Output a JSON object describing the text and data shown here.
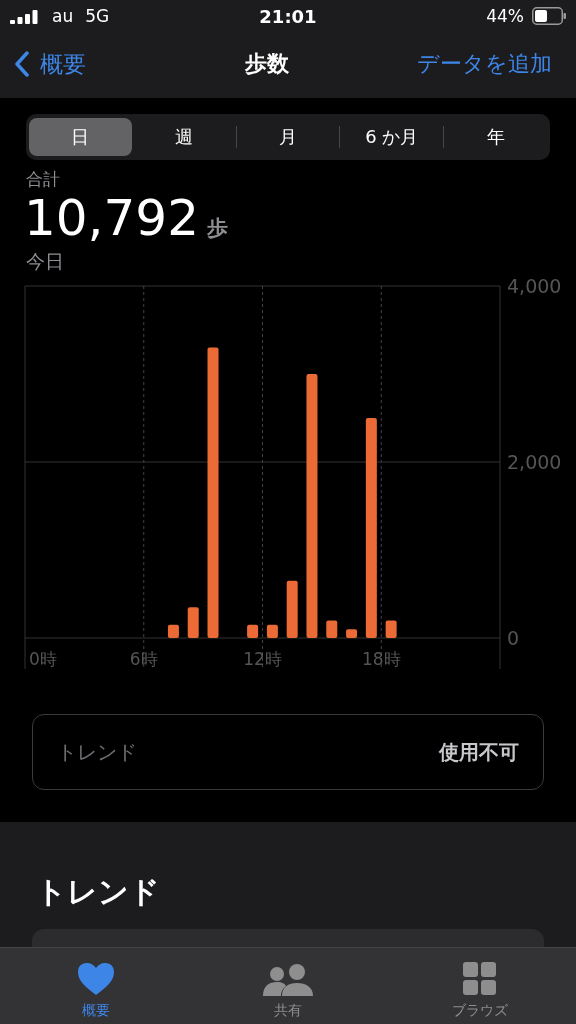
{
  "status_bar": {
    "carrier": "au",
    "network": "5G",
    "time": "21:01",
    "battery": "44%"
  },
  "nav": {
    "back": "概要",
    "title": "歩数",
    "action": "データを追加"
  },
  "segments": [
    {
      "label": "日",
      "selected": true
    },
    {
      "label": "週",
      "selected": false
    },
    {
      "label": "月",
      "selected": false
    },
    {
      "label": "6 か月",
      "selected": false
    },
    {
      "label": "年",
      "selected": false
    }
  ],
  "summary": {
    "label": "合計",
    "value": "10,792",
    "unit": "歩",
    "period": "今日"
  },
  "chart": {
    "chart_data": {
      "type": "bar",
      "grid": true,
      "ref_lines": [
        {
          "axis": "y",
          "value": 2000
        }
      ],
      "x": [
        7.5,
        8.5,
        9.5,
        11.5,
        12.5,
        13.5,
        14.5,
        15.5,
        16.5,
        17.5,
        18.5
      ],
      "xlim": [
        0,
        24
      ],
      "series": [
        {
          "color": "#ec6a35",
          "values": [
            150,
            350,
            3300,
            150,
            150,
            650,
            3000,
            200,
            100,
            2500,
            200
          ]
        }
      ],
      "ylim": [
        0,
        4000
      ],
      "yticks": [
        {
          "value": 0,
          "label": "0"
        },
        {
          "value": 2000,
          "label": "2,000"
        },
        {
          "value": 4000,
          "label": "4,000"
        }
      ],
      "xticks": [
        {
          "value": 0,
          "label": "0時"
        },
        {
          "value": 6,
          "label": "6時"
        },
        {
          "value": 12,
          "label": "12時"
        },
        {
          "value": 18,
          "label": "18時"
        }
      ]
    }
  },
  "trend_row": {
    "label": "トレンド",
    "value": "使用不可"
  },
  "trends_section": {
    "heading": "トレンド"
  },
  "tab_bar": [
    {
      "label": "概要",
      "selected": true
    },
    {
      "label": "共有",
      "selected": false
    },
    {
      "label": "ブラウズ",
      "selected": false
    }
  ]
}
